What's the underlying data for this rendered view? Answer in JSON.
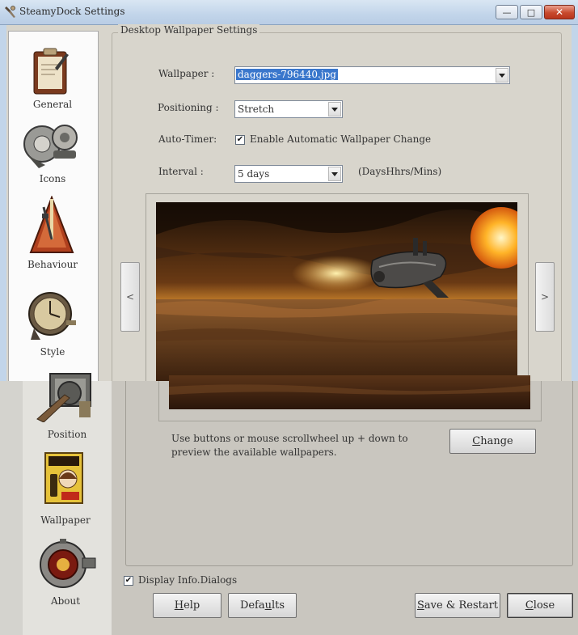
{
  "window": {
    "title": "SteamyDock Settings",
    "minimize_glyph": "—",
    "maximize_glyph": "□",
    "close_glyph": "✕"
  },
  "sidebar": {
    "items": [
      {
        "label": "General",
        "icon": "general-clipboard-icon"
      },
      {
        "label": "Icons",
        "icon": "icons-gears-icon"
      },
      {
        "label": "Behaviour",
        "icon": "behaviour-metronome-icon"
      },
      {
        "label": "Style",
        "icon": "style-clock-icon"
      },
      {
        "label": "Position",
        "icon": "position-monitor-icon"
      },
      {
        "label": "Wallpaper",
        "icon": "wallpaper-poster-icon"
      },
      {
        "label": "About",
        "icon": "about-gauge-icon"
      }
    ]
  },
  "panel": {
    "legend": "Desktop Wallpaper Settings",
    "wallpaper_label": "Wallpaper :",
    "wallpaper_value": "daggers-796440.jpg",
    "positioning_label": "Positioning :",
    "positioning_value": "Stretch",
    "autotimer_label": "Auto-Timer:",
    "autotimer_checkbox_label": "Enable Automatic Wallpaper Change",
    "autotimer_checked": true,
    "interval_label": "Interval :",
    "interval_value": "5 days",
    "interval_hint": "(DaysHhrs/Mins)",
    "prev_arrow": "<",
    "next_arrow": ">",
    "hint_text": "Use buttons or  mouse scrollwheel up + down to preview the available wallpapers.",
    "change_button": {
      "underline": "C",
      "rest": "hange"
    }
  },
  "footer": {
    "display_info_label": "Display Info.Dialogs",
    "display_info_checked": true,
    "help_button": {
      "underline": "H",
      "rest": "elp"
    },
    "defaults_button": {
      "pre": "Defa",
      "underline": "u",
      "rest": "lts"
    },
    "save_button": {
      "underline": "S",
      "rest": "ave & Restart"
    },
    "close_button": {
      "underline": "C",
      "rest": "lose"
    }
  },
  "colors": {
    "selection": "#3a77cc",
    "titlebar": "#c2d5ea",
    "close_button": "#c84a2e"
  }
}
